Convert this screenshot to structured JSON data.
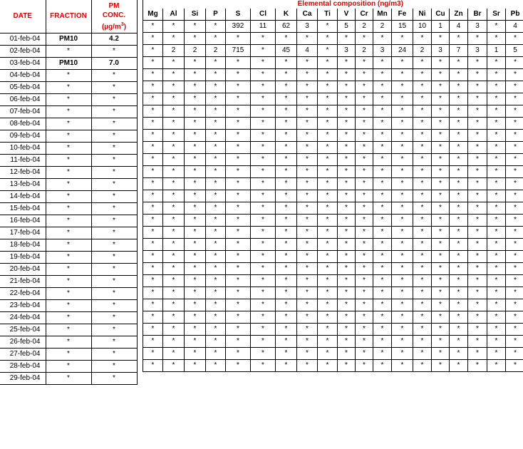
{
  "headers": {
    "date": "DATE",
    "fraction": "FRACTION",
    "pm_conc_line1": "PM",
    "pm_conc_line2": "CONC.",
    "pm_conc_unit": "(µg/m",
    "pm_conc_unit_sup": "3",
    "pm_conc_unit_close": ")",
    "composition_title": "Elemental composition (ng/m3)"
  },
  "elements": [
    "Mg",
    "Al",
    "Si",
    "P",
    "S",
    "Cl",
    "K",
    "Ca",
    "Ti",
    "V",
    "Cr",
    "Mn",
    "Fe",
    "Ni",
    "Cu",
    "Zn",
    "Br",
    "Sr",
    "Pb"
  ],
  "rows": [
    {
      "date": "01-feb-04",
      "fraction": "PM10",
      "conc": "4.2",
      "values": [
        "*",
        "*",
        "*",
        "*",
        "392",
        "11",
        "62",
        "3",
        "*",
        "5",
        "2",
        "2",
        "15",
        "10",
        "1",
        "4",
        "3",
        "*",
        "4"
      ]
    },
    {
      "date": "02-feb-04",
      "fraction": "*",
      "conc": "*",
      "values": [
        "*",
        "*",
        "*",
        "*",
        "*",
        "*",
        "*",
        "*",
        "*",
        "*",
        "*",
        "*",
        "*",
        "*",
        "*",
        "*",
        "*",
        "*",
        "*"
      ]
    },
    {
      "date": "03-feb-04",
      "fraction": "PM10",
      "conc": "7.0",
      "values": [
        "*",
        "2",
        "2",
        "2",
        "715",
        "*",
        "45",
        "4",
        "*",
        "3",
        "2",
        "3",
        "24",
        "2",
        "3",
        "7",
        "3",
        "1",
        "5"
      ]
    },
    {
      "date": "04-feb-04",
      "fraction": "*",
      "conc": "*",
      "values": [
        "*",
        "*",
        "*",
        "*",
        "*",
        "*",
        "*",
        "*",
        "*",
        "*",
        "*",
        "*",
        "*",
        "*",
        "*",
        "*",
        "*",
        "*",
        "*"
      ]
    },
    {
      "date": "05-feb-04",
      "fraction": "*",
      "conc": "*",
      "values": [
        "*",
        "*",
        "*",
        "*",
        "*",
        "*",
        "*",
        "*",
        "*",
        "*",
        "*",
        "*",
        "*",
        "*",
        "*",
        "*",
        "*",
        "*",
        "*"
      ]
    },
    {
      "date": "06-feb-04",
      "fraction": "*",
      "conc": "*",
      "values": [
        "*",
        "*",
        "*",
        "*",
        "*",
        "*",
        "*",
        "*",
        "*",
        "*",
        "*",
        "*",
        "*",
        "*",
        "*",
        "*",
        "*",
        "*",
        "*"
      ]
    },
    {
      "date": "07-feb-04",
      "fraction": "*",
      "conc": "*",
      "values": [
        "*",
        "*",
        "*",
        "*",
        "*",
        "*",
        "*",
        "*",
        "*",
        "*",
        "*",
        "*",
        "*",
        "*",
        "*",
        "*",
        "*",
        "*",
        "*"
      ]
    },
    {
      "date": "08-feb-04",
      "fraction": "*",
      "conc": "*",
      "values": [
        "*",
        "*",
        "*",
        "*",
        "*",
        "*",
        "*",
        "*",
        "*",
        "*",
        "*",
        "*",
        "*",
        "*",
        "*",
        "*",
        "*",
        "*",
        "*"
      ]
    },
    {
      "date": "09-feb-04",
      "fraction": "*",
      "conc": "*",
      "values": [
        "*",
        "*",
        "*",
        "*",
        "*",
        "*",
        "*",
        "*",
        "*",
        "*",
        "*",
        "*",
        "*",
        "*",
        "*",
        "*",
        "*",
        "*",
        "*"
      ]
    },
    {
      "date": "10-feb-04",
      "fraction": "*",
      "conc": "*",
      "values": [
        "*",
        "*",
        "*",
        "*",
        "*",
        "*",
        "*",
        "*",
        "*",
        "*",
        "*",
        "*",
        "*",
        "*",
        "*",
        "*",
        "*",
        "*",
        "*"
      ]
    },
    {
      "date": "11-feb-04",
      "fraction": "*",
      "conc": "*",
      "values": [
        "*",
        "*",
        "*",
        "*",
        "*",
        "*",
        "*",
        "*",
        "*",
        "*",
        "*",
        "*",
        "*",
        "*",
        "*",
        "*",
        "*",
        "*",
        "*"
      ]
    },
    {
      "date": "12-feb-04",
      "fraction": "*",
      "conc": "*",
      "values": [
        "*",
        "*",
        "*",
        "*",
        "*",
        "*",
        "*",
        "*",
        "*",
        "*",
        "*",
        "*",
        "*",
        "*",
        "*",
        "*",
        "*",
        "*",
        "*"
      ]
    },
    {
      "date": "13-feb-04",
      "fraction": "*",
      "conc": "*",
      "values": [
        "*",
        "*",
        "*",
        "*",
        "*",
        "*",
        "*",
        "*",
        "*",
        "*",
        "*",
        "*",
        "*",
        "*",
        "*",
        "*",
        "*",
        "*",
        "*"
      ]
    },
    {
      "date": "14-feb-04",
      "fraction": "*",
      "conc": "*",
      "values": [
        "*",
        "*",
        "*",
        "*",
        "*",
        "*",
        "*",
        "*",
        "*",
        "*",
        "*",
        "*",
        "*",
        "*",
        "*",
        "*",
        "*",
        "*",
        "*"
      ]
    },
    {
      "date": "15-feb-04",
      "fraction": "*",
      "conc": "*",
      "values": [
        "*",
        "*",
        "*",
        "*",
        "*",
        "*",
        "*",
        "*",
        "*",
        "*",
        "*",
        "*",
        "*",
        "*",
        "*",
        "*",
        "*",
        "*",
        "*"
      ]
    },
    {
      "date": "16-feb-04",
      "fraction": "*",
      "conc": "*",
      "values": [
        "*",
        "*",
        "*",
        "*",
        "*",
        "*",
        "*",
        "*",
        "*",
        "*",
        "*",
        "*",
        "*",
        "*",
        "*",
        "*",
        "*",
        "*",
        "*"
      ]
    },
    {
      "date": "17-feb-04",
      "fraction": "*",
      "conc": "*",
      "values": [
        "*",
        "*",
        "*",
        "*",
        "*",
        "*",
        "*",
        "*",
        "*",
        "*",
        "*",
        "*",
        "*",
        "*",
        "*",
        "*",
        "*",
        "*",
        "*"
      ]
    },
    {
      "date": "18-feb-04",
      "fraction": "*",
      "conc": "*",
      "values": [
        "*",
        "*",
        "*",
        "*",
        "*",
        "*",
        "*",
        "*",
        "*",
        "*",
        "*",
        "*",
        "*",
        "*",
        "*",
        "*",
        "*",
        "*",
        "*"
      ]
    },
    {
      "date": "19-feb-04",
      "fraction": "*",
      "conc": "*",
      "values": [
        "*",
        "*",
        "*",
        "*",
        "*",
        "*",
        "*",
        "*",
        "*",
        "*",
        "*",
        "*",
        "*",
        "*",
        "*",
        "*",
        "*",
        "*",
        "*"
      ]
    },
    {
      "date": "20-feb-04",
      "fraction": "*",
      "conc": "*",
      "values": [
        "*",
        "*",
        "*",
        "*",
        "*",
        "*",
        "*",
        "*",
        "*",
        "*",
        "*",
        "*",
        "*",
        "*",
        "*",
        "*",
        "*",
        "*",
        "*"
      ]
    },
    {
      "date": "21-feb-04",
      "fraction": "*",
      "conc": "*",
      "values": [
        "*",
        "*",
        "*",
        "*",
        "*",
        "*",
        "*",
        "*",
        "*",
        "*",
        "*",
        "*",
        "*",
        "*",
        "*",
        "*",
        "*",
        "*",
        "*"
      ]
    },
    {
      "date": "22-feb-04",
      "fraction": "*",
      "conc": "*",
      "values": [
        "*",
        "*",
        "*",
        "*",
        "*",
        "*",
        "*",
        "*",
        "*",
        "*",
        "*",
        "*",
        "*",
        "*",
        "*",
        "*",
        "*",
        "*",
        "*"
      ]
    },
    {
      "date": "23-feb-04",
      "fraction": "*",
      "conc": "*",
      "values": [
        "*",
        "*",
        "*",
        "*",
        "*",
        "*",
        "*",
        "*",
        "*",
        "*",
        "*",
        "*",
        "*",
        "*",
        "*",
        "*",
        "*",
        "*",
        "*"
      ]
    },
    {
      "date": "24-feb-04",
      "fraction": "*",
      "conc": "*",
      "values": [
        "*",
        "*",
        "*",
        "*",
        "*",
        "*",
        "*",
        "*",
        "*",
        "*",
        "*",
        "*",
        "*",
        "*",
        "*",
        "*",
        "*",
        "*",
        "*"
      ]
    },
    {
      "date": "25-feb-04",
      "fraction": "*",
      "conc": "*",
      "values": [
        "*",
        "*",
        "*",
        "*",
        "*",
        "*",
        "*",
        "*",
        "*",
        "*",
        "*",
        "*",
        "*",
        "*",
        "*",
        "*",
        "*",
        "*",
        "*"
      ]
    },
    {
      "date": "26-feb-04",
      "fraction": "*",
      "conc": "*",
      "values": [
        "*",
        "*",
        "*",
        "*",
        "*",
        "*",
        "*",
        "*",
        "*",
        "*",
        "*",
        "*",
        "*",
        "*",
        "*",
        "*",
        "*",
        "*",
        "*"
      ]
    },
    {
      "date": "27-feb-04",
      "fraction": "*",
      "conc": "*",
      "values": [
        "*",
        "*",
        "*",
        "*",
        "*",
        "*",
        "*",
        "*",
        "*",
        "*",
        "*",
        "*",
        "*",
        "*",
        "*",
        "*",
        "*",
        "*",
        "*"
      ]
    },
    {
      "date": "28-feb-04",
      "fraction": "*",
      "conc": "*",
      "values": [
        "*",
        "*",
        "*",
        "*",
        "*",
        "*",
        "*",
        "*",
        "*",
        "*",
        "*",
        "*",
        "*",
        "*",
        "*",
        "*",
        "*",
        "*",
        "*"
      ]
    },
    {
      "date": "29-feb-04",
      "fraction": "*",
      "conc": "*",
      "values": [
        "*",
        "*",
        "*",
        "*",
        "*",
        "*",
        "*",
        "*",
        "*",
        "*",
        "*",
        "*",
        "*",
        "*",
        "*",
        "*",
        "*",
        "*",
        "*"
      ]
    }
  ],
  "colors": {
    "header_red": "#e00000",
    "grid": "#000000",
    "background": "#ffffff"
  }
}
